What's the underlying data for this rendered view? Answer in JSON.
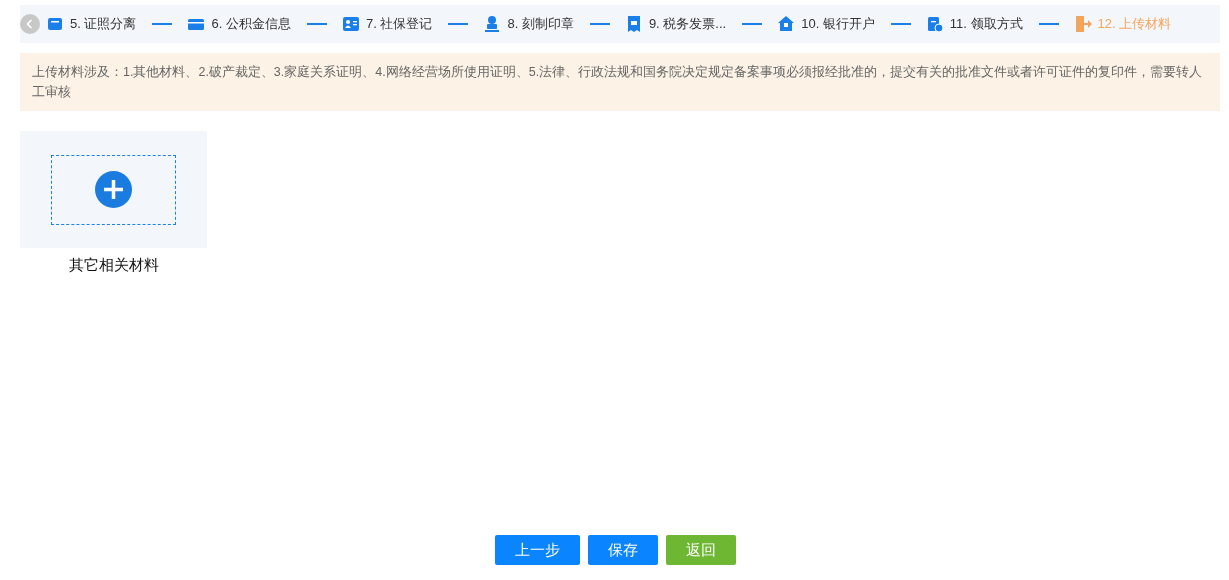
{
  "steps": [
    {
      "label": "5. 证照分离",
      "selected": false
    },
    {
      "label": "6. 公积金信息",
      "selected": false
    },
    {
      "label": "7. 社保登记",
      "selected": false
    },
    {
      "label": "8. 刻制印章",
      "selected": false
    },
    {
      "label": "9. 税务发票...",
      "selected": false
    },
    {
      "label": "10. 银行开户",
      "selected": false
    },
    {
      "label": "11. 领取方式",
      "selected": false
    },
    {
      "label": "12. 上传材料",
      "selected": true
    }
  ],
  "notice": "上传材料涉及：1.其他材料、2.破产裁定、3.家庭关系证明、4.网络经营场所使用证明、5.法律、行政法规和国务院决定规定备案事项必须报经批准的，提交有关的批准文件或者许可证件的复印件，需要转人工审核",
  "uploads": [
    {
      "label": "其它相关材料"
    }
  ],
  "buttons": [
    {
      "label": "上一步",
      "kind": "primary"
    },
    {
      "label": "保存",
      "kind": "primary"
    },
    {
      "label": "返回",
      "kind": "success"
    }
  ]
}
